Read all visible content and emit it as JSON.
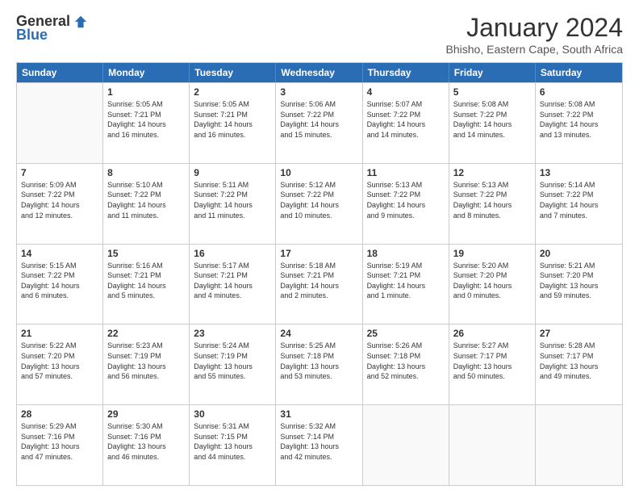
{
  "logo": {
    "general": "General",
    "blue": "Blue"
  },
  "title": "January 2024",
  "location": "Bhisho, Eastern Cape, South Africa",
  "header": {
    "days": [
      "Sunday",
      "Monday",
      "Tuesday",
      "Wednesday",
      "Thursday",
      "Friday",
      "Saturday"
    ]
  },
  "weeks": [
    [
      {
        "day": "",
        "content": ""
      },
      {
        "day": "1",
        "content": "Sunrise: 5:05 AM\nSunset: 7:21 PM\nDaylight: 14 hours\nand 16 minutes."
      },
      {
        "day": "2",
        "content": "Sunrise: 5:05 AM\nSunset: 7:21 PM\nDaylight: 14 hours\nand 16 minutes."
      },
      {
        "day": "3",
        "content": "Sunrise: 5:06 AM\nSunset: 7:22 PM\nDaylight: 14 hours\nand 15 minutes."
      },
      {
        "day": "4",
        "content": "Sunrise: 5:07 AM\nSunset: 7:22 PM\nDaylight: 14 hours\nand 14 minutes."
      },
      {
        "day": "5",
        "content": "Sunrise: 5:08 AM\nSunset: 7:22 PM\nDaylight: 14 hours\nand 14 minutes."
      },
      {
        "day": "6",
        "content": "Sunrise: 5:08 AM\nSunset: 7:22 PM\nDaylight: 14 hours\nand 13 minutes."
      }
    ],
    [
      {
        "day": "7",
        "content": "Sunrise: 5:09 AM\nSunset: 7:22 PM\nDaylight: 14 hours\nand 12 minutes."
      },
      {
        "day": "8",
        "content": "Sunrise: 5:10 AM\nSunset: 7:22 PM\nDaylight: 14 hours\nand 11 minutes."
      },
      {
        "day": "9",
        "content": "Sunrise: 5:11 AM\nSunset: 7:22 PM\nDaylight: 14 hours\nand 11 minutes."
      },
      {
        "day": "10",
        "content": "Sunrise: 5:12 AM\nSunset: 7:22 PM\nDaylight: 14 hours\nand 10 minutes."
      },
      {
        "day": "11",
        "content": "Sunrise: 5:13 AM\nSunset: 7:22 PM\nDaylight: 14 hours\nand 9 minutes."
      },
      {
        "day": "12",
        "content": "Sunrise: 5:13 AM\nSunset: 7:22 PM\nDaylight: 14 hours\nand 8 minutes."
      },
      {
        "day": "13",
        "content": "Sunrise: 5:14 AM\nSunset: 7:22 PM\nDaylight: 14 hours\nand 7 minutes."
      }
    ],
    [
      {
        "day": "14",
        "content": "Sunrise: 5:15 AM\nSunset: 7:22 PM\nDaylight: 14 hours\nand 6 minutes."
      },
      {
        "day": "15",
        "content": "Sunrise: 5:16 AM\nSunset: 7:21 PM\nDaylight: 14 hours\nand 5 minutes."
      },
      {
        "day": "16",
        "content": "Sunrise: 5:17 AM\nSunset: 7:21 PM\nDaylight: 14 hours\nand 4 minutes."
      },
      {
        "day": "17",
        "content": "Sunrise: 5:18 AM\nSunset: 7:21 PM\nDaylight: 14 hours\nand 2 minutes."
      },
      {
        "day": "18",
        "content": "Sunrise: 5:19 AM\nSunset: 7:21 PM\nDaylight: 14 hours\nand 1 minute."
      },
      {
        "day": "19",
        "content": "Sunrise: 5:20 AM\nSunset: 7:20 PM\nDaylight: 14 hours\nand 0 minutes."
      },
      {
        "day": "20",
        "content": "Sunrise: 5:21 AM\nSunset: 7:20 PM\nDaylight: 13 hours\nand 59 minutes."
      }
    ],
    [
      {
        "day": "21",
        "content": "Sunrise: 5:22 AM\nSunset: 7:20 PM\nDaylight: 13 hours\nand 57 minutes."
      },
      {
        "day": "22",
        "content": "Sunrise: 5:23 AM\nSunset: 7:19 PM\nDaylight: 13 hours\nand 56 minutes."
      },
      {
        "day": "23",
        "content": "Sunrise: 5:24 AM\nSunset: 7:19 PM\nDaylight: 13 hours\nand 55 minutes."
      },
      {
        "day": "24",
        "content": "Sunrise: 5:25 AM\nSunset: 7:18 PM\nDaylight: 13 hours\nand 53 minutes."
      },
      {
        "day": "25",
        "content": "Sunrise: 5:26 AM\nSunset: 7:18 PM\nDaylight: 13 hours\nand 52 minutes."
      },
      {
        "day": "26",
        "content": "Sunrise: 5:27 AM\nSunset: 7:17 PM\nDaylight: 13 hours\nand 50 minutes."
      },
      {
        "day": "27",
        "content": "Sunrise: 5:28 AM\nSunset: 7:17 PM\nDaylight: 13 hours\nand 49 minutes."
      }
    ],
    [
      {
        "day": "28",
        "content": "Sunrise: 5:29 AM\nSunset: 7:16 PM\nDaylight: 13 hours\nand 47 minutes."
      },
      {
        "day": "29",
        "content": "Sunrise: 5:30 AM\nSunset: 7:16 PM\nDaylight: 13 hours\nand 46 minutes."
      },
      {
        "day": "30",
        "content": "Sunrise: 5:31 AM\nSunset: 7:15 PM\nDaylight: 13 hours\nand 44 minutes."
      },
      {
        "day": "31",
        "content": "Sunrise: 5:32 AM\nSunset: 7:14 PM\nDaylight: 13 hours\nand 42 minutes."
      },
      {
        "day": "",
        "content": ""
      },
      {
        "day": "",
        "content": ""
      },
      {
        "day": "",
        "content": ""
      }
    ]
  ]
}
